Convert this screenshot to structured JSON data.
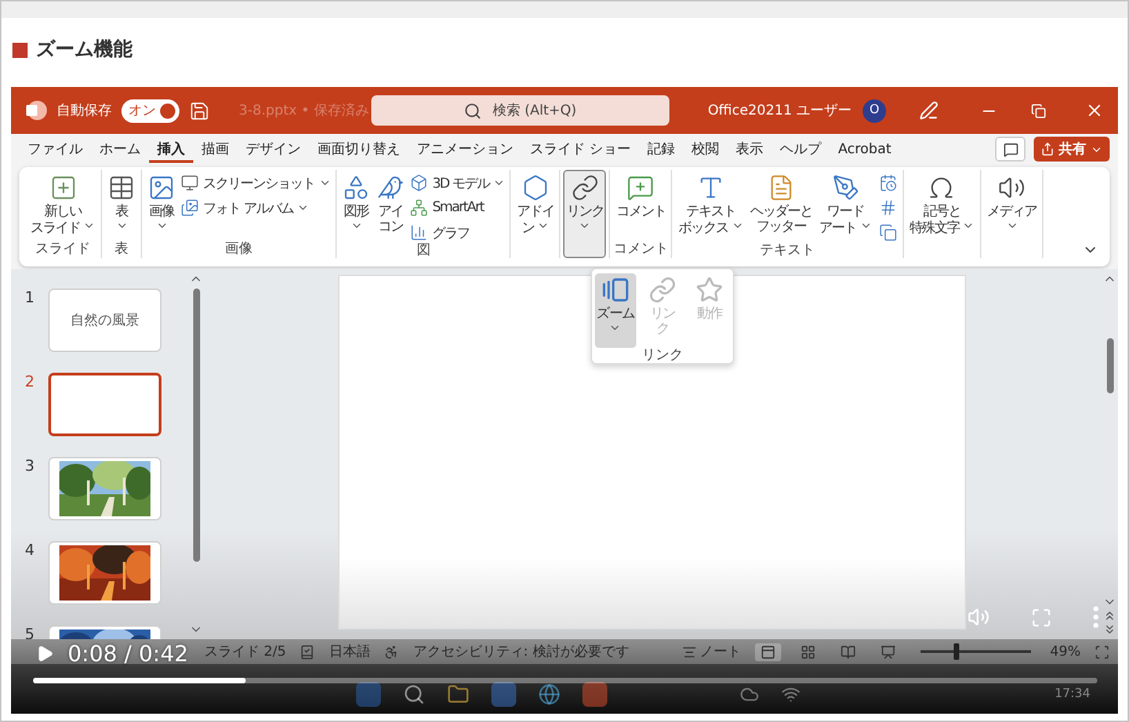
{
  "page_title": "ズーム機能",
  "app": {
    "title_bar": {
      "autosave_label": "自動保存",
      "autosave": {
        "label": "オン",
        "on": true
      },
      "file_name": "3-8.pptx • 保存済み",
      "search_placeholder": "検索 (Alt+Q)",
      "user_name": "Office20211 ユーザー",
      "avatar": "O"
    },
    "tabs": [
      {
        "label": "ファイル",
        "selected": false
      },
      {
        "label": "ホーム",
        "selected": false
      },
      {
        "label": "挿入",
        "selected": true
      },
      {
        "label": "描画",
        "selected": false
      },
      {
        "label": "デザイン",
        "selected": false
      },
      {
        "label": "画面切り替え",
        "selected": false
      },
      {
        "label": "アニメーション",
        "selected": false
      },
      {
        "label": "スライド ショー",
        "selected": false
      },
      {
        "label": "記録",
        "selected": false
      },
      {
        "label": "校閲",
        "selected": false
      },
      {
        "label": "表示",
        "selected": false
      },
      {
        "label": "ヘルプ",
        "selected": false
      },
      {
        "label": "Acrobat",
        "selected": false
      }
    ],
    "share_button": "共有",
    "ribbon_groups": [
      {
        "label": "スライド",
        "items": [
          {
            "kind": "large",
            "lines": [
              "新しい",
              "スライド"
            ],
            "dropdown": true,
            "pressed": false
          }
        ]
      },
      {
        "label": "表",
        "items": [
          {
            "kind": "large",
            "lines": [
              "表"
            ],
            "dropdown": true,
            "pressed": false
          }
        ]
      },
      {
        "label": "画像",
        "items": [
          {
            "kind": "large",
            "lines": [
              "画像"
            ],
            "dropdown": true,
            "pressed": false
          },
          {
            "kind": "stack",
            "items": [
              {
                "label": "スクリーンショット",
                "dropdown": true
              },
              {
                "label": "フォト アルバム",
                "dropdown": true
              }
            ]
          }
        ]
      },
      {
        "label": "図",
        "items": [
          {
            "kind": "large",
            "lines": [
              "図形"
            ],
            "dropdown": true,
            "pressed": false
          },
          {
            "kind": "large",
            "lines": [
              "アイ",
              "コン"
            ],
            "dropdown": false,
            "pressed": false
          },
          {
            "kind": "stack",
            "items": [
              {
                "label": "3D モデル",
                "dropdown": true
              },
              {
                "label": "SmartArt",
                "dropdown": false
              },
              {
                "label": "グラフ",
                "dropdown": false
              }
            ]
          }
        ]
      },
      {
        "items": [
          {
            "kind": "large",
            "lines": [
              "アドイ",
              "ン"
            ],
            "dropdown": true,
            "pressed": false
          }
        ]
      },
      {
        "items": [
          {
            "kind": "large",
            "lines": [
              "リンク"
            ],
            "dropdown": true,
            "pressed": true
          }
        ]
      },
      {
        "label": "コメント",
        "items": [
          {
            "kind": "large",
            "lines": [
              "コメント"
            ],
            "dropdown": false,
            "pressed": false
          }
        ]
      },
      {
        "label": "テキスト",
        "items": [
          {
            "kind": "large",
            "lines": [
              "テキスト",
              "ボックス"
            ],
            "dropdown": true,
            "pressed": false
          },
          {
            "kind": "large",
            "lines": [
              "ヘッダーと",
              "フッター"
            ],
            "dropdown": false,
            "pressed": false
          },
          {
            "kind": "large",
            "lines": [
              "ワード",
              "アート"
            ],
            "dropdown": true,
            "pressed": false
          },
          {
            "kind": "icon_stack"
          }
        ]
      },
      {
        "items": [
          {
            "kind": "large",
            "lines": [
              "記号と",
              "特殊文字"
            ],
            "dropdown": true,
            "pressed": false
          }
        ]
      },
      {
        "items": [
          {
            "kind": "large",
            "lines": [
              "メディア"
            ],
            "dropdown": true,
            "pressed": false
          }
        ]
      }
    ],
    "link_menu": {
      "label": "リンク",
      "items": [
        {
          "lines": [
            "ズーム"
          ],
          "dropdown": true,
          "selected": true,
          "disabled": false
        },
        {
          "lines": [
            "リン",
            "ク"
          ],
          "dropdown": false,
          "selected": false,
          "disabled": true
        },
        {
          "lines": [
            "動作"
          ],
          "dropdown": false,
          "selected": false,
          "disabled": true
        }
      ]
    },
    "thumbnails": [
      {
        "number": "1",
        "kind": "title",
        "title": "自然の風景",
        "selected": false
      },
      {
        "number": "2",
        "kind": "blank",
        "selected": true
      },
      {
        "number": "3",
        "kind": "picture",
        "selected": false
      },
      {
        "number": "4",
        "kind": "picture",
        "selected": false
      },
      {
        "number": "5",
        "kind": "picture",
        "selected": false
      }
    ],
    "status_bar": {
      "slide": "スライド 2/5",
      "language": "日本語",
      "accessibility": "アクセシビリティ: 検討が必要です",
      "notes": "ノート",
      "views": [
        {
          "selected": true
        },
        {
          "selected": false
        },
        {
          "selected": false
        },
        {
          "selected": false
        }
      ],
      "zoom": {
        "level": 0.3
      },
      "zoom_value": "49%"
    },
    "taskbar": {
      "time": "17:34"
    }
  },
  "video": {
    "time": "0:08 / 0:42",
    "progress": {
      "level": 0.2
    }
  }
}
